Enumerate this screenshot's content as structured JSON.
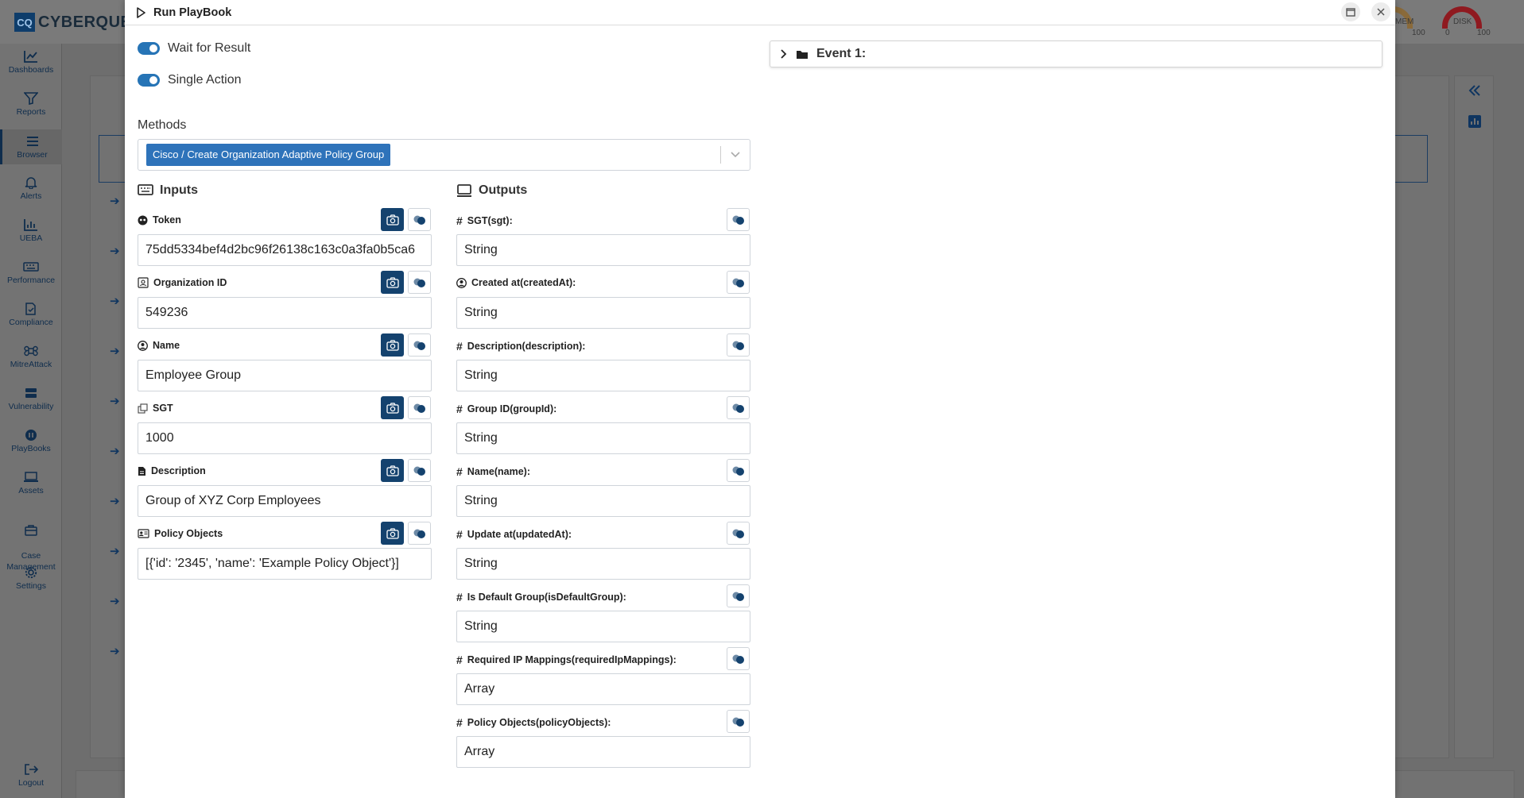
{
  "app": {
    "logo_short": "CQ",
    "logo_text": "CYBERQUES",
    "gauges": [
      {
        "label": "MEM",
        "min": "",
        "max": "100",
        "color": "#b06a1a"
      },
      {
        "label": "DISK",
        "min": "0",
        "max": "100",
        "color": "#a0141b"
      }
    ]
  },
  "sidebar": {
    "items": [
      {
        "label": "Dashboards",
        "icon": "chart-line-icon"
      },
      {
        "label": "Reports",
        "icon": "filter-icon"
      },
      {
        "label": "Browser",
        "icon": "list-icon",
        "active": true
      },
      {
        "label": "Alerts",
        "icon": "bell-icon"
      },
      {
        "label": "UEBA",
        "icon": "chart-icon"
      },
      {
        "label": "Performance",
        "icon": "keyboard-icon"
      },
      {
        "label": "Compliance",
        "icon": "file-check-icon"
      },
      {
        "label": "MitreAttack",
        "icon": "command-icon"
      },
      {
        "label": "Vulnerability",
        "icon": "server-icon"
      },
      {
        "label": "PlayBooks",
        "icon": "pause-circle-icon"
      },
      {
        "label": "Assets",
        "icon": "laptop-icon"
      },
      {
        "label": "Case\nManagement",
        "icon": "briefcase-icon"
      },
      {
        "label": "Settings",
        "icon": "gear-icon"
      }
    ],
    "logout": "Logout"
  },
  "modal": {
    "title": "Run PlayBook",
    "toggles": [
      {
        "label": "Wait for Result",
        "on": true
      },
      {
        "label": "Single Action",
        "on": true
      }
    ],
    "methods_label": "Methods",
    "method_selected": "Cisco / Create Organization Adaptive Policy Group",
    "inputs_title": "Inputs",
    "outputs_title": "Outputs",
    "inputs": [
      {
        "label": "Token",
        "icon": "mask-icon",
        "value": "75dd5334bef4d2bc96f26138c163c0a3fa0b5ca6"
      },
      {
        "label": "Organization ID",
        "icon": "id-badge-icon",
        "value": "549236"
      },
      {
        "label": "Name",
        "icon": "user-circle-icon",
        "value": "Employee Group"
      },
      {
        "label": "SGT",
        "icon": "copy-icon",
        "value": "1000"
      },
      {
        "label": "Description",
        "icon": "file-icon",
        "value": "Group of XYZ Corp Employees"
      },
      {
        "label": "Policy Objects",
        "icon": "id-card-icon",
        "value": "[{'id': '2345', 'name': 'Example Policy Object'}]"
      }
    ],
    "outputs": [
      {
        "label": "SGT(sgt):",
        "icon": "hash-icon",
        "value": "String"
      },
      {
        "label": "Created at(createdAt):",
        "icon": "user-circle-icon",
        "value": "String"
      },
      {
        "label": "Description(description):",
        "icon": "hash-icon",
        "value": "String"
      },
      {
        "label": "Group ID(groupId):",
        "icon": "hash-icon",
        "value": "String"
      },
      {
        "label": "Name(name):",
        "icon": "hash-icon",
        "value": "String"
      },
      {
        "label": "Update at(updatedAt):",
        "icon": "hash-icon",
        "value": "String"
      },
      {
        "label": "Is Default Group(isDefaultGroup):",
        "icon": "hash-icon",
        "value": "String"
      },
      {
        "label": "Required IP Mappings(requiredIpMappings):",
        "icon": "hash-icon",
        "value": "Array"
      },
      {
        "label": "Policy Objects(policyObjects):",
        "icon": "hash-icon",
        "value": "Array"
      }
    ],
    "event_label": "Event 1:"
  }
}
